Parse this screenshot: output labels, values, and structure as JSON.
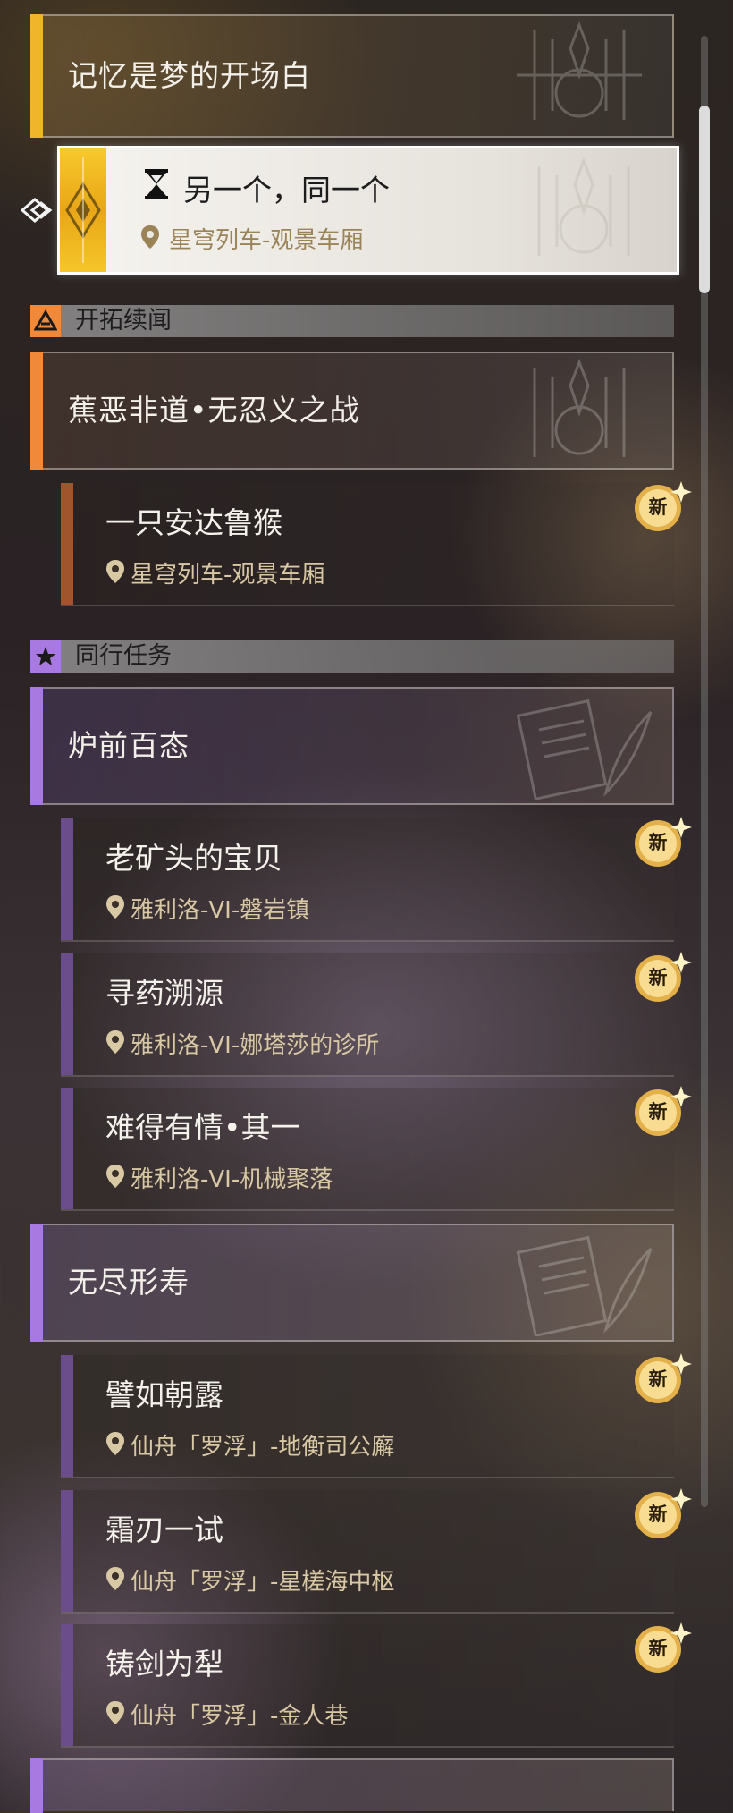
{
  "colors": {
    "gold": "#f0b52a",
    "orange": "#f08a3a",
    "brown": "#a0552c",
    "purple": "#a879e0",
    "purple_dark": "#6c4d8c",
    "location_text": "#d9c8a4"
  },
  "main_story": {
    "title": "记忆是梦的开场白",
    "active_quest": {
      "name": "另一个，同一个",
      "location": "星穹列车-观景车厢",
      "icon": "hourglass-icon"
    }
  },
  "sections": [
    {
      "label": "开拓续闻",
      "icon": "trailblaze-icon",
      "groups": [
        {
          "title": "蕉恶非道•无忍义之战",
          "quests": [
            {
              "name": "一只安达鲁猴",
              "location": "星穹列车-观景车厢",
              "badge": "新"
            }
          ]
        }
      ]
    },
    {
      "label": "同行任务",
      "icon": "star-icon",
      "groups": [
        {
          "title": "炉前百态",
          "quests": [
            {
              "name": "老矿头的宝贝",
              "location": "雅利洛-VI-磐岩镇",
              "badge": "新"
            },
            {
              "name": "寻药溯源",
              "location": "雅利洛-VI-娜塔莎的诊所",
              "badge": "新"
            },
            {
              "name": "难得有情•其一",
              "location": "雅利洛-VI-机械聚落",
              "badge": "新"
            }
          ]
        },
        {
          "title": "无尽形寿",
          "quests": [
            {
              "name": "譬如朝露",
              "location": "仙舟「罗浮」-地衡司公廨",
              "badge": "新"
            },
            {
              "name": "霜刃一试",
              "location": "仙舟「罗浮」-星槎海中枢",
              "badge": "新"
            },
            {
              "name": "铸剑为犁",
              "location": "仙舟「罗浮」-金人巷",
              "badge": "新"
            }
          ]
        }
      ]
    }
  ]
}
